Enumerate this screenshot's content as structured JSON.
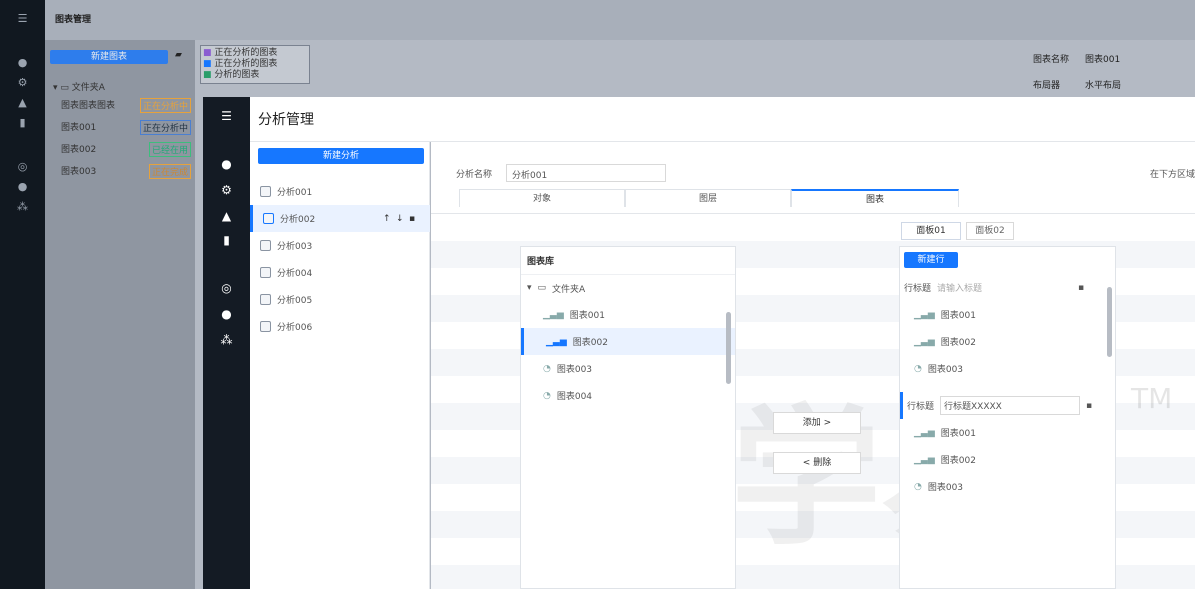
{
  "background": {
    "header_title": "图表管理",
    "new_button": "新建图表",
    "tree_root": "文件夹A",
    "tree_items": [
      {
        "label": "图表图表图表",
        "tag": "正在分析中"
      },
      {
        "label": "图表001",
        "tag": "正在分析中"
      },
      {
        "label": "图表002",
        "tag": "已经在用"
      },
      {
        "label": "图表003",
        "tag": "正在完成"
      }
    ],
    "legend": [
      "正在分析的图表",
      "正在分析的图表",
      "分析的图表"
    ],
    "right_fields": [
      {
        "label": "图表名称",
        "value": "图表001"
      },
      {
        "label": "布局器",
        "value": "水平布局"
      }
    ]
  },
  "app": {
    "title": "分析管理",
    "new_analysis": "新建分析",
    "analyses": [
      "分析001",
      "分析002",
      "分析003",
      "分析004",
      "分析005",
      "分析006"
    ],
    "selected_index": 1,
    "top_right_text": "在下方区域"
  },
  "form": {
    "name_label": "分析名称",
    "name_value": "分析001",
    "tabs": [
      "对象",
      "图层",
      "图表"
    ],
    "active_tab": 2
  },
  "library": {
    "title": "图表库",
    "folder": "文件夹A",
    "items": [
      "图表001",
      "图表002",
      "图表003",
      "图表004"
    ],
    "selected_index": 1
  },
  "actions": {
    "add": "添加 >",
    "remove": "< 删除"
  },
  "target": {
    "tabs": [
      "面板01",
      "面板02"
    ],
    "new_row": "新建行",
    "row_label": "行标题",
    "row1_placeholder": "请输入标题",
    "row2_value": "行标题XXXXX",
    "row1_items": [
      "图表001",
      "图表002",
      "图表003"
    ],
    "row2_items": [
      "图表001",
      "图表002",
      "图表003"
    ]
  },
  "watermark": {
    "text": "学易",
    "tm": "TM"
  },
  "colors": {
    "accent": "#1677ff",
    "rail": "#141b24"
  }
}
